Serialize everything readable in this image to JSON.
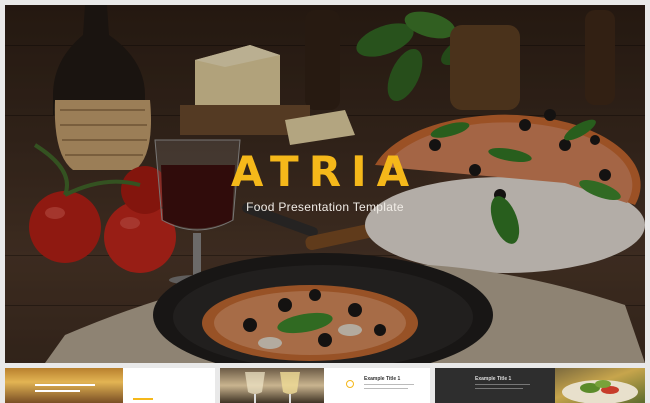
{
  "hero": {
    "title": "ATRIA",
    "subtitle": "Food Presentation Template"
  },
  "thumbnails": [
    {
      "title": ""
    },
    {
      "title": ""
    },
    {
      "title": ""
    },
    {
      "title": "Example Title 1"
    },
    {
      "title": "Example Title 1"
    },
    {
      "title": ""
    }
  ],
  "colors": {
    "accent": "#f5b81a",
    "wood_dark": "#2a1d14"
  }
}
